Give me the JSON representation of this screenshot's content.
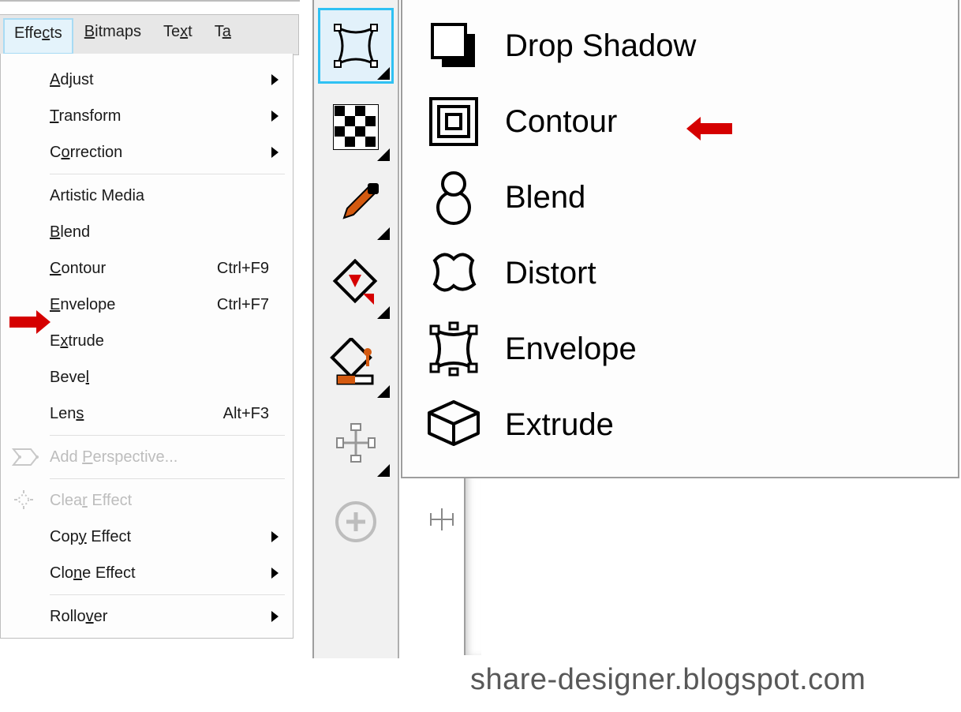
{
  "menubar": {
    "items": [
      {
        "label": "Effects",
        "accel": "c"
      },
      {
        "label": "Bitmaps",
        "accel": "B"
      },
      {
        "label": "Text",
        "accel": "x"
      },
      {
        "label": "Ta",
        "accel": "a"
      }
    ],
    "active_index": 0
  },
  "dropdown": {
    "groups": [
      [
        {
          "label": "Adjust",
          "accel": "A",
          "submenu": true
        },
        {
          "label": "Transform",
          "accel": "T",
          "submenu": true
        },
        {
          "label": "Correction",
          "accel": "O",
          "submenu": true
        }
      ],
      [
        {
          "label": "Artistic Media"
        },
        {
          "label": "Blend",
          "accel": "B"
        },
        {
          "label": "Contour",
          "accel": "C",
          "shortcut": "Ctrl+F9"
        },
        {
          "label": "Envelope",
          "accel": "E",
          "shortcut": "Ctrl+F7",
          "arrow": "left"
        },
        {
          "label": "Extrude",
          "accel": "x"
        },
        {
          "label": "Bevel",
          "accel": "l"
        },
        {
          "label": "Lens",
          "accel": "s",
          "shortcut": "Alt+F3"
        }
      ],
      [
        {
          "label": "Add Perspective...",
          "accel": "P",
          "disabled": true,
          "icon": "perspective"
        }
      ],
      [
        {
          "label": "Clear Effect",
          "accel": "r",
          "disabled": true,
          "icon": "clear-effect"
        },
        {
          "label": "Copy Effect",
          "accel": "y",
          "submenu": true
        },
        {
          "label": "Clone Effect",
          "accel": "n",
          "submenu": true
        }
      ],
      [
        {
          "label": "Rollover",
          "accel": "v",
          "submenu": true
        }
      ]
    ]
  },
  "toolbox": {
    "tools": [
      {
        "name": "envelope-tool",
        "active": true,
        "flyout": true
      },
      {
        "name": "transparency-tool",
        "flyout": true
      },
      {
        "name": "eyedropper-tool",
        "flyout": true
      },
      {
        "name": "outline-tool",
        "flyout": true
      },
      {
        "name": "fill-tool",
        "flyout": true
      },
      {
        "name": "interactive-fill-tool",
        "flyout": true
      },
      {
        "name": "zoom-tool"
      }
    ]
  },
  "flyout": {
    "items": [
      {
        "label": "Drop Shadow",
        "icon": "drop-shadow",
        "arrow": null
      },
      {
        "label": "Contour",
        "icon": "contour",
        "arrow": "right"
      },
      {
        "label": "Blend",
        "icon": "blend"
      },
      {
        "label": "Distort",
        "icon": "distort"
      },
      {
        "label": "Envelope",
        "icon": "envelope"
      },
      {
        "label": "Extrude",
        "icon": "extrude"
      }
    ]
  },
  "watermark": "share-designer.blogspot.com"
}
